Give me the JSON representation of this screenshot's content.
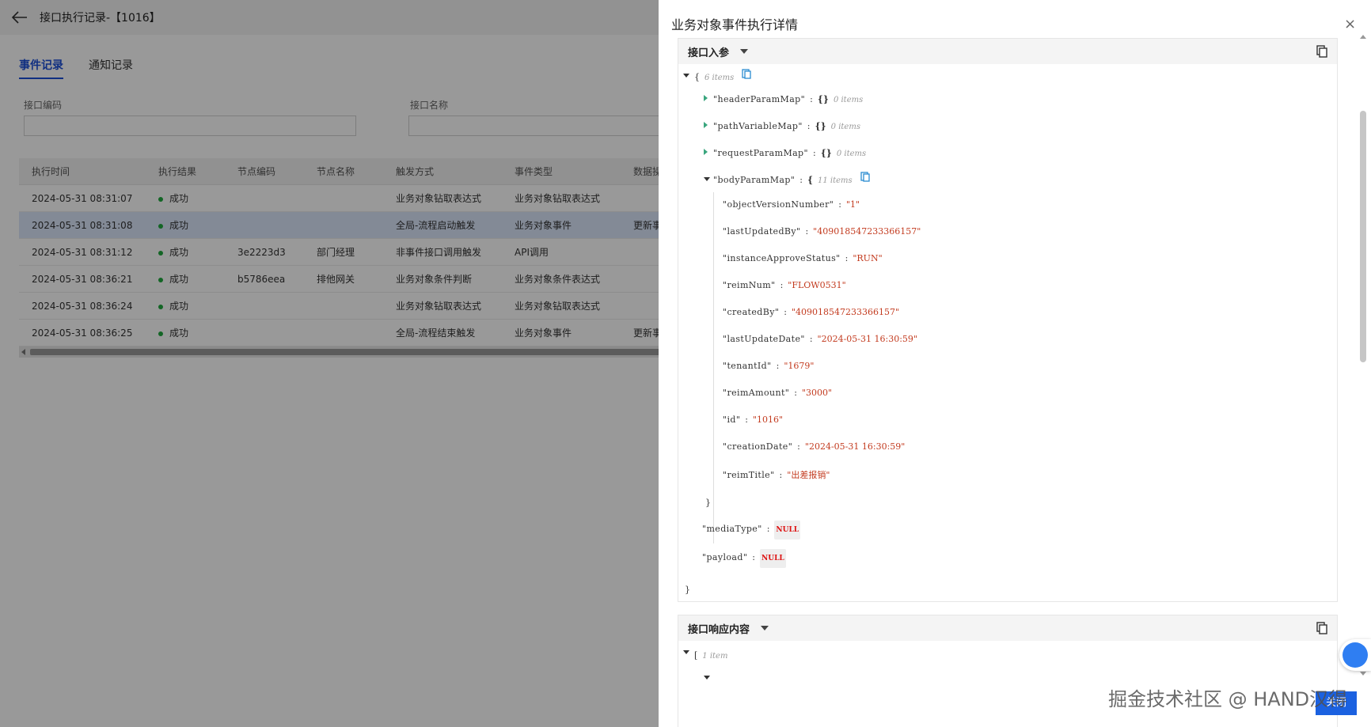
{
  "page": {
    "title": "接口执行记录-【1016】",
    "tabs": [
      {
        "label": "事件记录",
        "active": true
      },
      {
        "label": "通知记录",
        "active": false
      }
    ],
    "filters": {
      "code_label": "接口编码",
      "name_label": "接口名称",
      "code_value": "",
      "name_value": ""
    },
    "table": {
      "headers": [
        "执行时间",
        "执行结果",
        "节点编码",
        "节点名称",
        "触发方式",
        "事件类型",
        "数据操"
      ],
      "rows": [
        {
          "time": "2024-05-31 08:31:07",
          "result": "成功",
          "node_code": "",
          "node_name": "",
          "trigger": "业务对象钻取表达式",
          "event_type": "业务对象钻取表达式",
          "data": ""
        },
        {
          "time": "2024-05-31 08:31:08",
          "result": "成功",
          "node_code": "",
          "node_name": "",
          "trigger": "全局-流程启动触发",
          "event_type": "业务对象事件",
          "data": "更新事"
        },
        {
          "time": "2024-05-31 08:31:12",
          "result": "成功",
          "node_code": "3e2223d3",
          "node_name": "部门经理",
          "trigger": "非事件接口调用触发",
          "event_type": "API调用",
          "data": ""
        },
        {
          "time": "2024-05-31 08:36:21",
          "result": "成功",
          "node_code": "b5786eea",
          "node_name": "排他网关",
          "trigger": "业务对象条件判断",
          "event_type": "业务对象条件表达式",
          "data": ""
        },
        {
          "time": "2024-05-31 08:36:24",
          "result": "成功",
          "node_code": "",
          "node_name": "",
          "trigger": "业务对象钻取表达式",
          "event_type": "业务对象钻取表达式",
          "data": ""
        },
        {
          "time": "2024-05-31 08:36:25",
          "result": "成功",
          "node_code": "",
          "node_name": "",
          "trigger": "全局-流程结束触发",
          "event_type": "业务对象事件",
          "data": "更新事"
        }
      ],
      "selected_row": 1
    }
  },
  "drawer": {
    "title": "业务对象事件执行详情",
    "close_symbol": "×",
    "request_section": {
      "label": "接口入参",
      "root": {
        "open": "{",
        "close": "}",
        "count": "6 items"
      },
      "collapsed": [
        {
          "key": "\"headerParamMap\"",
          "value": "{}",
          "count": "0 items"
        },
        {
          "key": "\"pathVariableMap\"",
          "value": "{}",
          "count": "0 items"
        },
        {
          "key": "\"requestParamMap\"",
          "value": "{}",
          "count": "0 items"
        }
      ],
      "body": {
        "key": "\"bodyParamMap\"",
        "open": "{",
        "close": "}",
        "count": "11 items",
        "fields": [
          {
            "key": "\"objectVersionNumber\"",
            "value": "\"1\""
          },
          {
            "key": "\"lastUpdatedBy\"",
            "value": "\"409018547233366157\""
          },
          {
            "key": "\"instanceApproveStatus\"",
            "value": "\"RUN\""
          },
          {
            "key": "\"reimNum\"",
            "value": "\"FLOW0531\""
          },
          {
            "key": "\"createdBy\"",
            "value": "\"409018547233366157\""
          },
          {
            "key": "\"lastUpdateDate\"",
            "value": "\"2024-05-31 16:30:59\""
          },
          {
            "key": "\"tenantId\"",
            "value": "\"1679\""
          },
          {
            "key": "\"reimAmount\"",
            "value": "\"3000\""
          },
          {
            "key": "\"id\"",
            "value": "\"1016\""
          },
          {
            "key": "\"creationDate\"",
            "value": "\"2024-05-31 16:30:59\""
          },
          {
            "key": "\"reimTitle\"",
            "value": "\"出差报销\""
          }
        ]
      },
      "media_type": {
        "key": "\"mediaType\"",
        "value": "NULL"
      },
      "payload": {
        "key": "\"payload\"",
        "value": "NULL"
      },
      "colon": ":"
    },
    "response_section": {
      "label": "接口响应内容",
      "root": {
        "open": "[",
        "count": "1 item"
      }
    },
    "close_button": "关闭"
  },
  "watermark": "掘金技术社区 @ HAND汉得",
  "colors": {
    "accent": "#1b4fd8",
    "success": "#21a83e",
    "json_string": "#c33b1f",
    "json_null": "#dd1111",
    "selected_row": "#dbe6fb"
  }
}
